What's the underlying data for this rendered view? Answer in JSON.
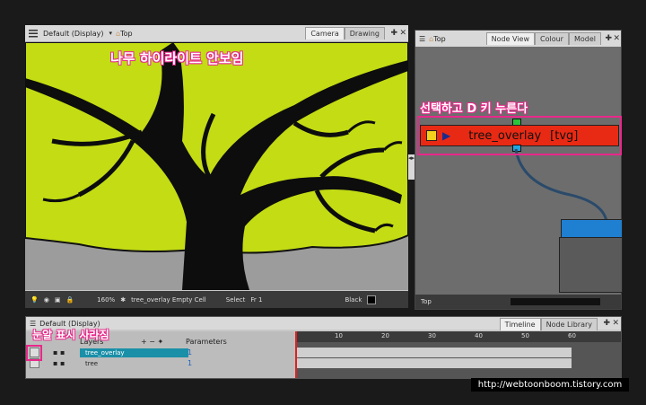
{
  "camera": {
    "view_label": "Default (Display)",
    "breadcrumb": "Top",
    "tabs": [
      "Camera",
      "Drawing"
    ],
    "footer": {
      "zoom": "160%",
      "cell": "tree_overlay Empty Cell",
      "tool": "Select",
      "frame": "Fr 1",
      "color": "Black"
    }
  },
  "annotations": {
    "tree_note": "나무 하이라이트 안보임",
    "node_note": "선택하고 D 키 누른다",
    "eye_note": "눈알 표시 사라짐"
  },
  "node_view": {
    "breadcrumb": "Top",
    "tabs": [
      "Node View",
      "Colour",
      "Model"
    ],
    "node_name": "tree_overlay",
    "node_type": "[tvg]",
    "footer_label": "Top"
  },
  "timeline": {
    "view_label": "Default (Display)",
    "tabs": [
      "Timeline",
      "Node Library"
    ],
    "parameters_label": "Parameters",
    "layers_label": "Layers",
    "layers": [
      {
        "name": "tree_overlay",
        "value": "1"
      },
      {
        "name": "tree",
        "value": "1"
      }
    ],
    "ruler": [
      "10",
      "20",
      "30",
      "40",
      "50",
      "60"
    ]
  },
  "watermark": "http://webtoonboom.tistory.com",
  "colors": {
    "node_red": "#e82a14",
    "highlight_pink": "#e8288a",
    "tree_green": "#c3dc14"
  }
}
